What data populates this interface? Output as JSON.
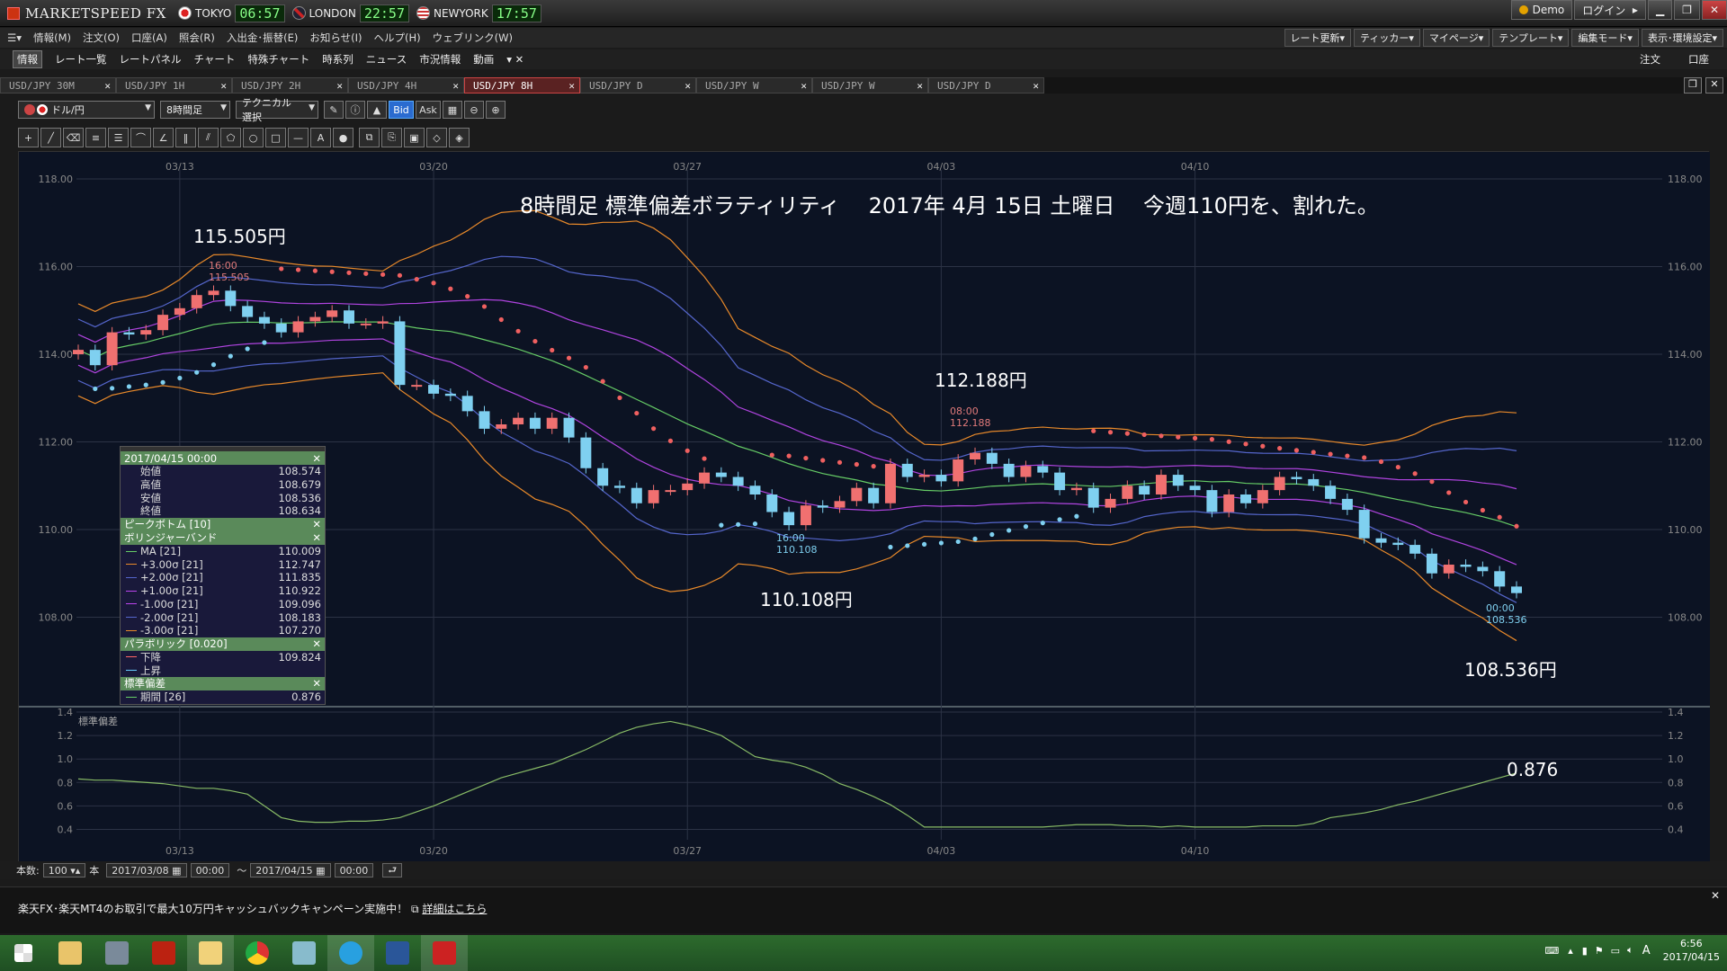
{
  "app": {
    "title": "MARKETSPEED FX"
  },
  "markets": [
    {
      "name": "TOKYO",
      "time": "06:57",
      "flag_color": "#d22"
    },
    {
      "name": "LONDON",
      "time": "22:57",
      "flag_color": "#336"
    },
    {
      "name": "NEWYORK",
      "time": "17:57",
      "flag_color": "#a33"
    }
  ],
  "window": {
    "demo": "Demo",
    "login": "ログイン"
  },
  "menu": [
    "情報(M)",
    "注文(O)",
    "口座(A)",
    "照会(R)",
    "入出金･振替(E)",
    "お知らせ(I)",
    "ヘルプ(H)",
    "ウェブリンク(W)"
  ],
  "menu_right": [
    "レート更新▾",
    "ティッカー▾",
    "マイページ▾",
    "テンプレート▾",
    "編集モード▾",
    "表示･環境設定▾"
  ],
  "funcbar": [
    "情報",
    "レート一覧",
    "レートパネル",
    "チャート",
    "特殊チャート",
    "時系列",
    "ニュース",
    "市況情報",
    "動画"
  ],
  "funcbar_right": [
    "注文",
    "口座"
  ],
  "tabs": [
    {
      "label": "USD/JPY 30M",
      "active": false
    },
    {
      "label": "USD/JPY 1H",
      "active": false
    },
    {
      "label": "USD/JPY 2H",
      "active": false
    },
    {
      "label": "USD/JPY 4H",
      "active": false
    },
    {
      "label": "USD/JPY 8H",
      "active": true
    },
    {
      "label": "USD/JPY D",
      "active": false
    },
    {
      "label": "USD/JPY W",
      "active": false
    },
    {
      "label": "USD/JPY W",
      "active": false
    },
    {
      "label": "USD/JPY D",
      "active": false
    }
  ],
  "toolbar": {
    "pair": "ドル/円",
    "period": "8時間足",
    "technical": "テクニカル選択",
    "bid": "Bid",
    "ask": "Ask"
  },
  "chart_data": {
    "type": "candlestick",
    "title": "8時間足 標準偏差ボラティリティ　 2017年 4月 15日 土曜日　 今週110円を、割れた。",
    "annotations": {
      "high1": "115.505円",
      "high2": "112.188円",
      "low1": "110.108円",
      "last": "108.536円",
      "sd_last": "0.876",
      "high1_time": "16:00",
      "high1_val": "115.505",
      "high2_time": "08:00",
      "high2_val": "112.188",
      "low1_time": "16:00",
      "low1_val": "110.108",
      "last_time": "00:00",
      "last_val": "108.536"
    },
    "x_ticks": [
      "03/13",
      "03/20",
      "03/27",
      "04/03",
      "04/10"
    ],
    "y_ticks": [
      "118.00",
      "116.00",
      "114.00",
      "112.00",
      "110.00",
      "108.00"
    ],
    "ylim": [
      106.0,
      118.0
    ],
    "sub_label": "標準偏差",
    "sub_ticks": [
      "1.4",
      "1.2",
      "1.0",
      "0.8",
      "0.6",
      "0.4"
    ],
    "sub_ylim": [
      0.35,
      1.4
    ],
    "closes": [
      114.1,
      113.75,
      114.5,
      114.45,
      114.55,
      114.9,
      115.05,
      115.35,
      115.45,
      115.1,
      114.85,
      114.7,
      114.5,
      114.75,
      114.85,
      115.0,
      114.7,
      114.7,
      114.75,
      113.3,
      113.3,
      113.1,
      113.05,
      112.7,
      112.3,
      112.4,
      112.55,
      112.3,
      112.55,
      112.1,
      111.4,
      111.0,
      110.95,
      110.6,
      110.9,
      110.9,
      111.05,
      111.3,
      111.2,
      111.0,
      110.8,
      110.4,
      110.1,
      110.55,
      110.5,
      110.65,
      110.95,
      110.6,
      111.5,
      111.2,
      111.25,
      111.1,
      111.6,
      111.75,
      111.5,
      111.2,
      111.45,
      111.3,
      110.9,
      110.95,
      110.5,
      110.7,
      111.0,
      110.8,
      111.25,
      111.0,
      110.9,
      110.4,
      110.8,
      110.6,
      110.9,
      111.2,
      111.15,
      111.0,
      110.7,
      110.45,
      109.8,
      109.7,
      109.65,
      109.45,
      109.0,
      109.2,
      109.15,
      109.05,
      108.7,
      108.55
    ],
    "sd": [
      0.83,
      0.82,
      0.82,
      0.81,
      0.8,
      0.79,
      0.77,
      0.75,
      0.75,
      0.73,
      0.7,
      0.6,
      0.5,
      0.47,
      0.46,
      0.46,
      0.47,
      0.47,
      0.48,
      0.5,
      0.55,
      0.6,
      0.66,
      0.72,
      0.78,
      0.84,
      0.88,
      0.92,
      0.96,
      1.02,
      1.08,
      1.15,
      1.22,
      1.27,
      1.3,
      1.32,
      1.29,
      1.25,
      1.2,
      1.11,
      1.02,
      0.99,
      0.97,
      0.93,
      0.87,
      0.79,
      0.74,
      0.68,
      0.61,
      0.52,
      0.42,
      0.42,
      0.42,
      0.42,
      0.42,
      0.42,
      0.42,
      0.42,
      0.43,
      0.44,
      0.44,
      0.44,
      0.43,
      0.43,
      0.42,
      0.43,
      0.42,
      0.42,
      0.42,
      0.42,
      0.43,
      0.43,
      0.43,
      0.45,
      0.5,
      0.52,
      0.54,
      0.57,
      0.61,
      0.64,
      0.68,
      0.72,
      0.76,
      0.8,
      0.84,
      0.88
    ]
  },
  "info_panel": {
    "date": "2017/04/15 00:00",
    "ohlc": [
      {
        "label": "始値",
        "value": "108.574"
      },
      {
        "label": "高値",
        "value": "108.679"
      },
      {
        "label": "安値",
        "value": "108.536"
      },
      {
        "label": "終値",
        "value": "108.634"
      }
    ],
    "peak_bottom": "ピークボトム [10]",
    "bollinger": "ボリンジャーバンド",
    "bb_rows": [
      {
        "label": "MA [21]",
        "value": "110.009",
        "color": "#6c6"
      },
      {
        "label": "+3.00σ [21]",
        "value": "112.747",
        "color": "#e8892a"
      },
      {
        "label": "+2.00σ [21]",
        "value": "111.835",
        "color": "#56c"
      },
      {
        "label": "+1.00σ [21]",
        "value": "110.922",
        "color": "#b4e"
      },
      {
        "label": "-1.00σ [21]",
        "value": "109.096",
        "color": "#b4e"
      },
      {
        "label": "-2.00σ [21]",
        "value": "108.183",
        "color": "#56c"
      },
      {
        "label": "-3.00σ [21]",
        "value": "107.270",
        "color": "#e8892a"
      }
    ],
    "parabolic": "パラボリック [0.020]",
    "sar_rows": [
      {
        "label": "下降",
        "value": "109.824",
        "color": "#f66"
      },
      {
        "label": "上昇",
        "value": "",
        "color": "#6cf"
      }
    ],
    "std_dev": "標準偏差",
    "std_rows": [
      {
        "label": "期間 [26]",
        "value": "0.876",
        "color": "#6c6"
      }
    ]
  },
  "bottom": {
    "count_label": "本数:",
    "count": "100",
    "unit": "本",
    "from_date": "2017/03/08",
    "from_time": "00:00",
    "tilde": "～",
    "to_date": "2017/04/15",
    "to_time": "00:00"
  },
  "news": {
    "text": "楽天FX･楽天MT4のお取引で最大10万円キャッシュバックキャンペーン実施中！",
    "link": "詳細はこちら"
  },
  "taskbar": {
    "time": "6:56",
    "date": "2017/04/15",
    "ime": "A"
  }
}
